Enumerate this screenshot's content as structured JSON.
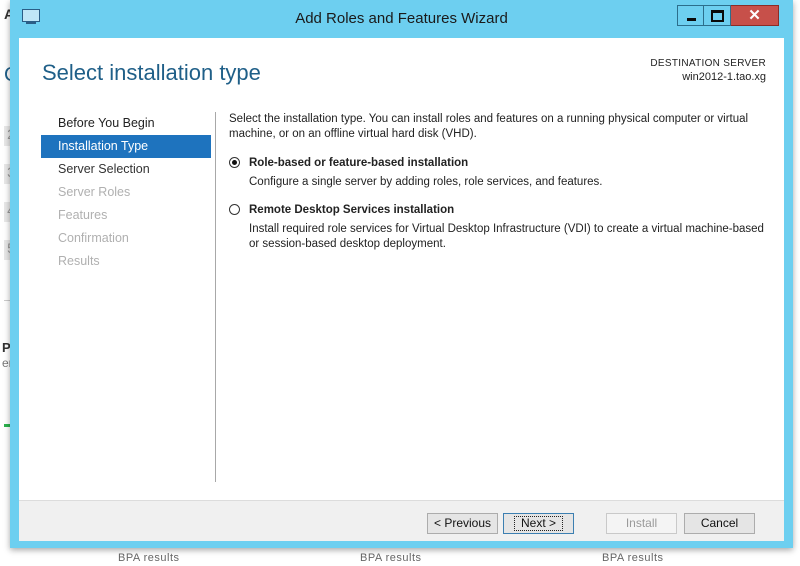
{
  "background": {
    "fragments": [
      "A",
      "C",
      "PS",
      "erv"
    ],
    "step_numbers": [
      "2",
      "3",
      "4",
      "5"
    ],
    "bpa_results": [
      "BPA results",
      "BPA results",
      "BPA results"
    ]
  },
  "window": {
    "title": "Add Roles and Features Wizard",
    "controls": {
      "minimize_icon": "minimize-icon",
      "maximize_icon": "maximize-icon",
      "close_icon": "close-icon",
      "close_glyph": "✕"
    },
    "accent_color": "#6dcff0"
  },
  "header": {
    "page_title": "Select installation type",
    "destination_label": "DESTINATION SERVER",
    "destination_value": "win2012-1.tao.xg"
  },
  "nav": {
    "items": [
      {
        "label": "Before You Begin",
        "state": "done"
      },
      {
        "label": "Installation Type",
        "state": "active"
      },
      {
        "label": "Server Selection",
        "state": "next"
      },
      {
        "label": "Server Roles",
        "state": "disabled"
      },
      {
        "label": "Features",
        "state": "disabled"
      },
      {
        "label": "Confirmation",
        "state": "disabled"
      },
      {
        "label": "Results",
        "state": "disabled"
      }
    ],
    "active_color": "#1e73be"
  },
  "content": {
    "intro": "Select the installation type. You can install roles and features on a running physical computer or virtual machine, or on an offline virtual hard disk (VHD).",
    "options": [
      {
        "title": "Role-based or feature-based installation",
        "description": "Configure a single server by adding roles, role services, and features.",
        "selected": true
      },
      {
        "title": "Remote Desktop Services installation",
        "description": "Install required role services for Virtual Desktop Infrastructure (VDI) to create a virtual machine-based or session-based desktop deployment.",
        "selected": false
      }
    ]
  },
  "footer": {
    "previous_label": "< Previous",
    "next_label": "Next >",
    "install_label": "Install",
    "cancel_label": "Cancel"
  }
}
